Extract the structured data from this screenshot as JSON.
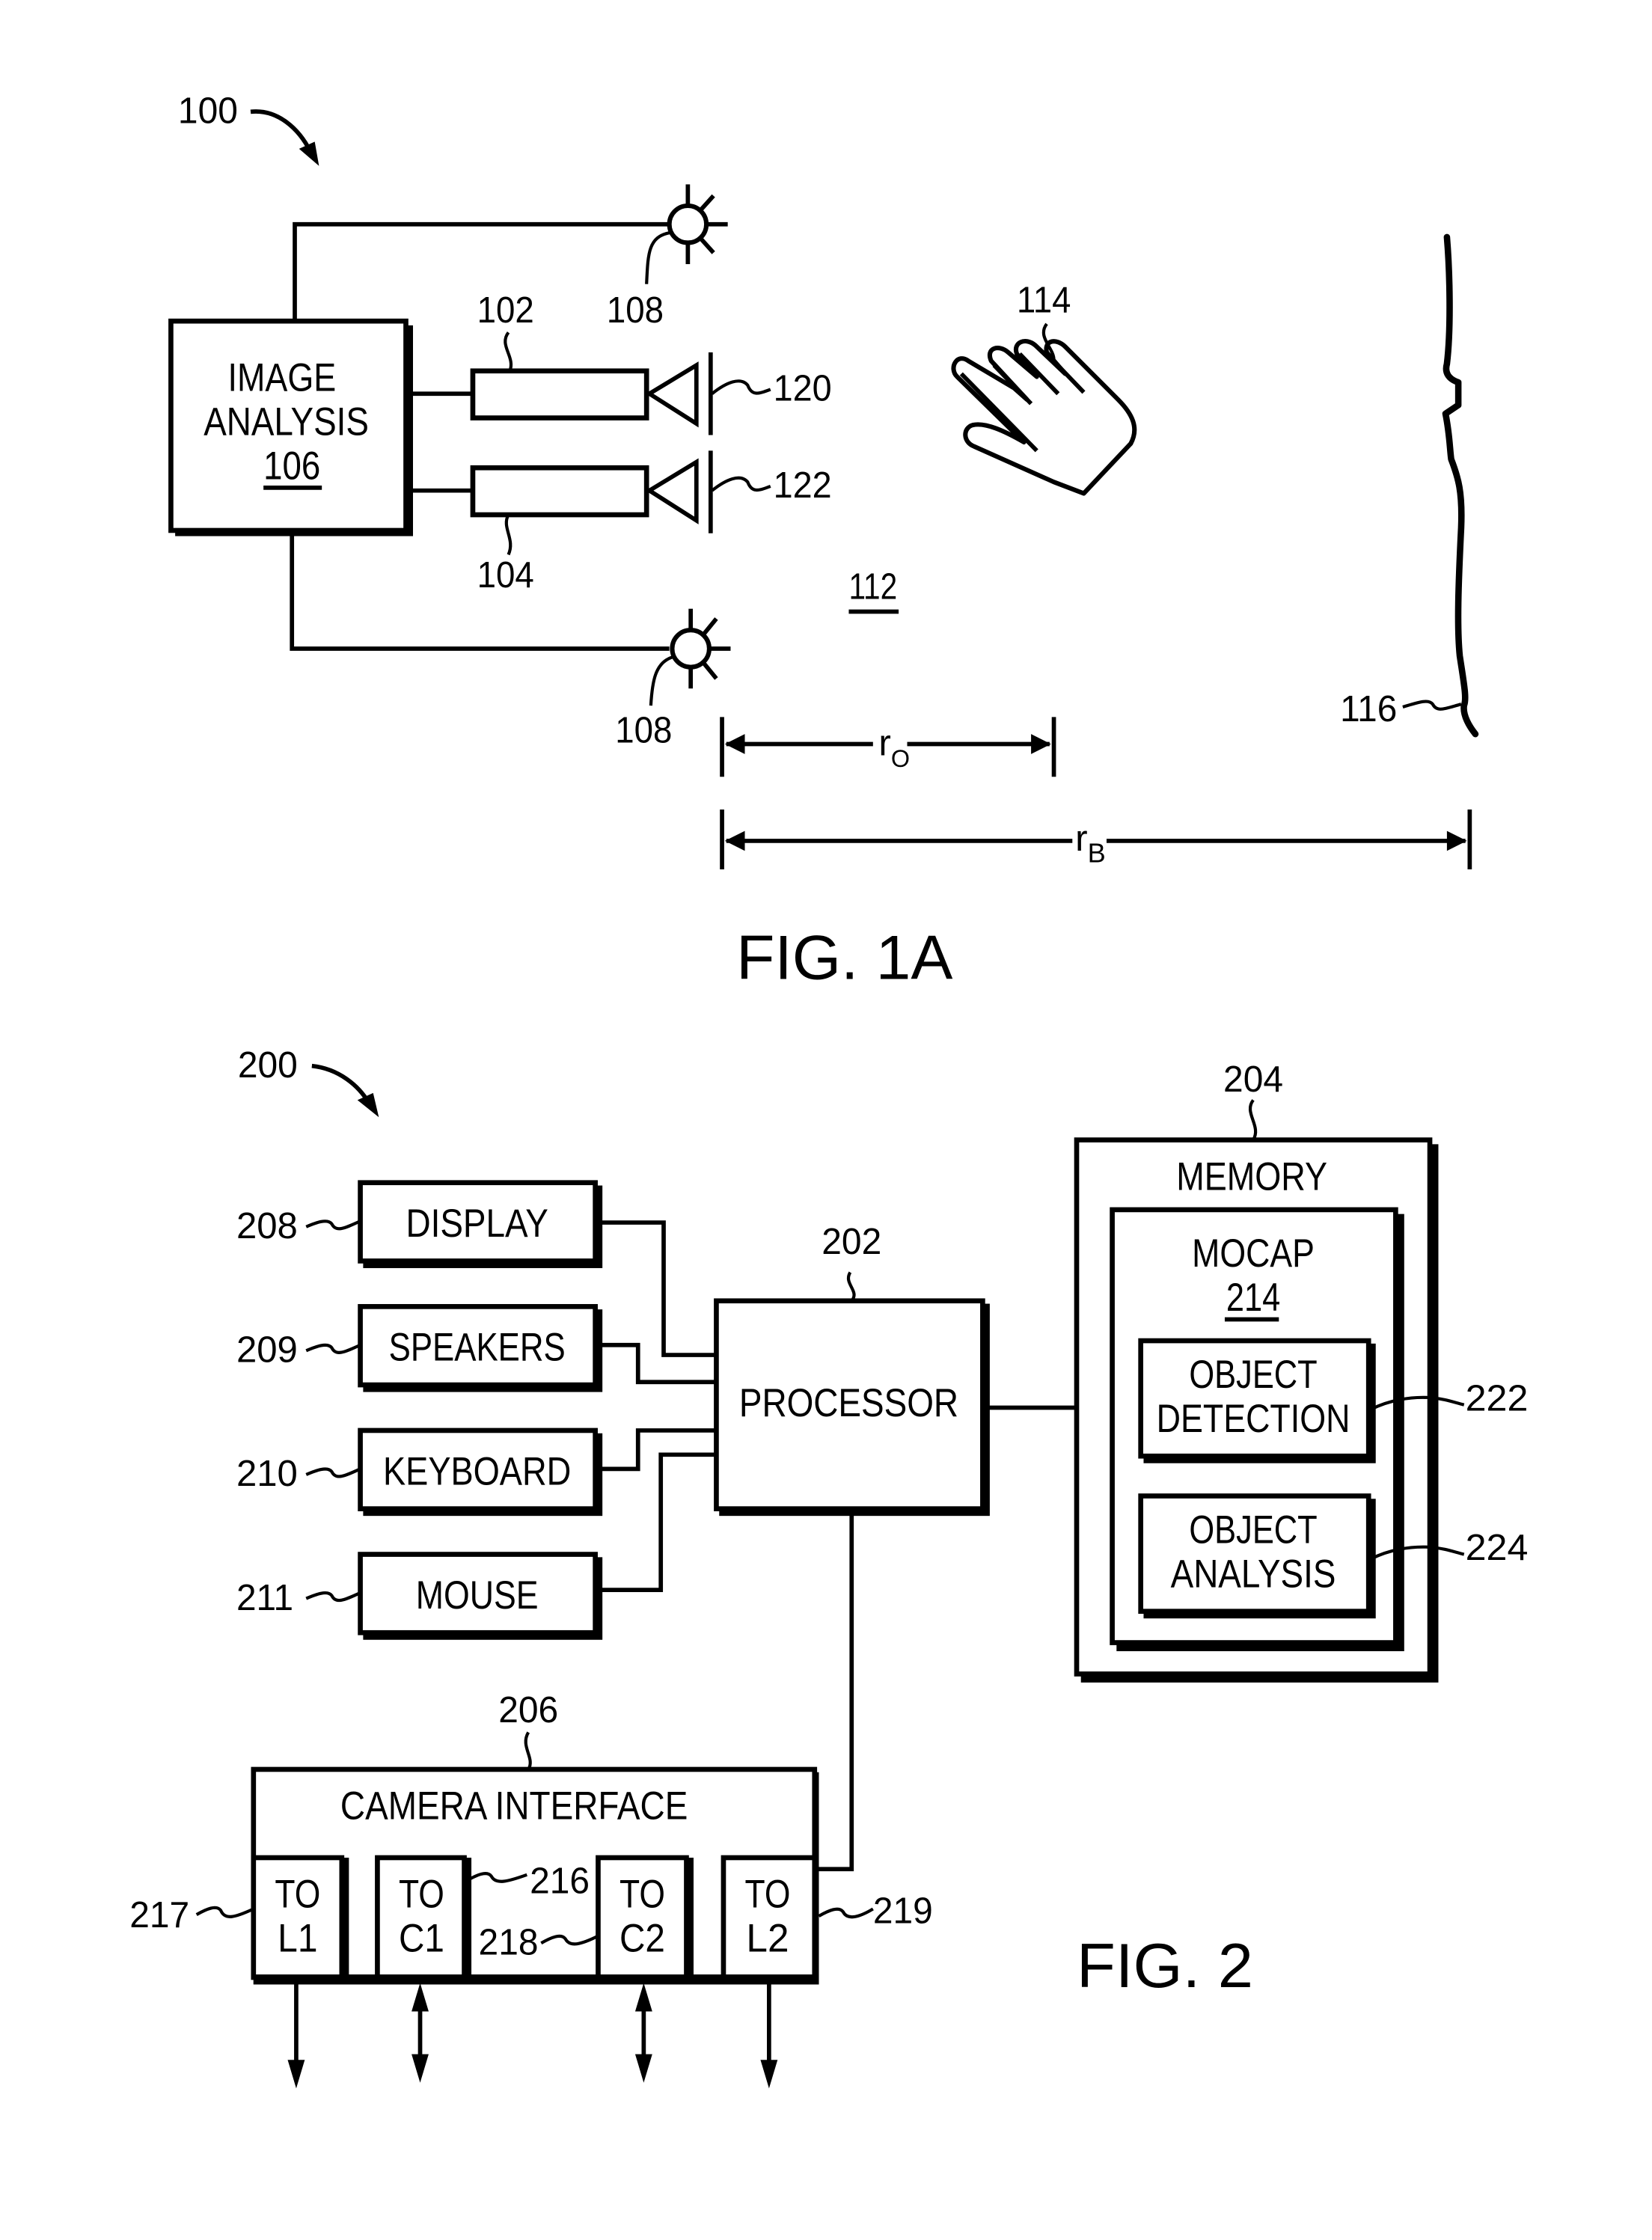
{
  "fig1a": {
    "caption": "FIG. 1A",
    "system_ref": "100",
    "image_analysis": {
      "line1": "IMAGE",
      "line2": "ANALYSIS",
      "ref": "106"
    },
    "camera_top_ref": "102",
    "camera_bottom_ref": "104",
    "light_top_ref": "108",
    "light_bottom_ref": "108",
    "lens_top_ref": "120",
    "lens_bottom_ref": "122",
    "hand_ref": "114",
    "region_ref": "112",
    "background_ref": "116",
    "dim_object": {
      "symbol": "r",
      "subscript": "O"
    },
    "dim_background": {
      "symbol": "r",
      "subscript": "B"
    }
  },
  "fig2": {
    "caption": "FIG. 2",
    "system_ref": "200",
    "peripherals": [
      {
        "label": "DISPLAY",
        "ref": "208"
      },
      {
        "label": "SPEAKERS",
        "ref": "209"
      },
      {
        "label": "KEYBOARD",
        "ref": "210"
      },
      {
        "label": "MOUSE",
        "ref": "211"
      }
    ],
    "processor": {
      "label": "PROCESSOR",
      "ref": "202"
    },
    "memory": {
      "label": "MEMORY",
      "ref": "204",
      "mocap": {
        "label": "MOCAP",
        "ref": "214"
      },
      "object_detection": {
        "line1": "OBJECT",
        "line2": "DETECTION",
        "ref": "222"
      },
      "object_analysis": {
        "line1": "OBJECT",
        "line2": "ANALYSIS",
        "ref": "224"
      }
    },
    "camera_interface": {
      "label": "CAMERA INTERFACE",
      "ref": "206",
      "ports": [
        {
          "line1": "TO",
          "line2": "L1",
          "ref": "217",
          "direction": "out"
        },
        {
          "line1": "TO",
          "line2": "C1",
          "ref": "216",
          "direction": "bidirectional"
        },
        {
          "line1": "TO",
          "line2": "C2",
          "ref": "218",
          "direction": "bidirectional"
        },
        {
          "line1": "TO",
          "line2": "L2",
          "ref": "219",
          "direction": "out"
        }
      ]
    }
  }
}
